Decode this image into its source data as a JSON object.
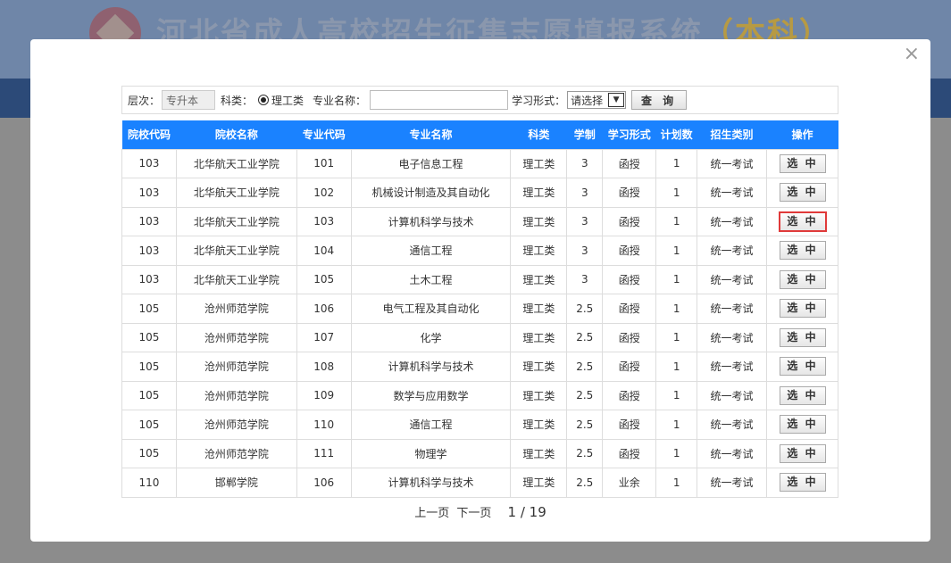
{
  "background": {
    "title_main": "河北省成人高校招生征集志愿填报系统",
    "title_accent": "（本科）"
  },
  "filters": {
    "level_label": "层次：",
    "level_value": "专升本",
    "subject_label": "科类：",
    "subject_option": "理工类",
    "major_label": "专业名称：",
    "major_value": "",
    "study_mode_label": "学习形式：",
    "study_mode_selected": "请选择",
    "query_button": "查 询"
  },
  "table": {
    "headers": [
      "院校代码",
      "院校名称",
      "专业代码",
      "专业名称",
      "科类",
      "学制",
      "学习形式",
      "计划数",
      "招生类别",
      "操作"
    ],
    "action_label": "选 中",
    "rows": [
      [
        "103",
        "北华航天工业学院",
        "101",
        "电子信息工程",
        "理工类",
        "3",
        "函授",
        "1",
        "统一考试"
      ],
      [
        "103",
        "北华航天工业学院",
        "102",
        "机械设计制造及其自动化",
        "理工类",
        "3",
        "函授",
        "1",
        "统一考试"
      ],
      [
        "103",
        "北华航天工业学院",
        "103",
        "计算机科学与技术",
        "理工类",
        "3",
        "函授",
        "1",
        "统一考试"
      ],
      [
        "103",
        "北华航天工业学院",
        "104",
        "通信工程",
        "理工类",
        "3",
        "函授",
        "1",
        "统一考试"
      ],
      [
        "103",
        "北华航天工业学院",
        "105",
        "土木工程",
        "理工类",
        "3",
        "函授",
        "1",
        "统一考试"
      ],
      [
        "105",
        "沧州师范学院",
        "106",
        "电气工程及其自动化",
        "理工类",
        "2.5",
        "函授",
        "1",
        "统一考试"
      ],
      [
        "105",
        "沧州师范学院",
        "107",
        "化学",
        "理工类",
        "2.5",
        "函授",
        "1",
        "统一考试"
      ],
      [
        "105",
        "沧州师范学院",
        "108",
        "计算机科学与技术",
        "理工类",
        "2.5",
        "函授",
        "1",
        "统一考试"
      ],
      [
        "105",
        "沧州师范学院",
        "109",
        "数学与应用数学",
        "理工类",
        "2.5",
        "函授",
        "1",
        "统一考试"
      ],
      [
        "105",
        "沧州师范学院",
        "110",
        "通信工程",
        "理工类",
        "2.5",
        "函授",
        "1",
        "统一考试"
      ],
      [
        "105",
        "沧州师范学院",
        "111",
        "物理学",
        "理工类",
        "2.5",
        "函授",
        "1",
        "统一考试"
      ],
      [
        "110",
        "邯郸学院",
        "106",
        "计算机科学与技术",
        "理工类",
        "2.5",
        "业余",
        "1",
        "统一考试"
      ]
    ],
    "highlighted_row": 2
  },
  "pager": {
    "prev": "上一页",
    "next": "下一页",
    "page_info": "1 / 19"
  },
  "colors": {
    "header_bg": "#1a82ff",
    "highlight_border": "#e03a3a"
  },
  "icons": {
    "close": "close-icon"
  }
}
